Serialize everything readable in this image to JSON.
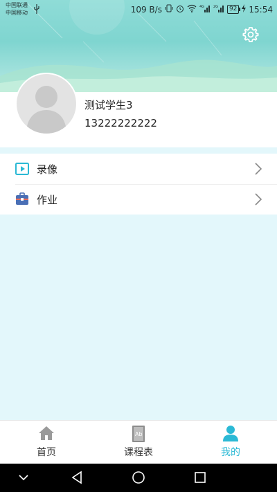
{
  "status_bar": {
    "carrier_1": "中国联通",
    "carrier_2": "中国移动",
    "net_speed": "109 B/s",
    "battery": "92",
    "time": "15:54"
  },
  "profile": {
    "name": "测试学生3",
    "phone": "13222222222"
  },
  "menu": {
    "items": [
      {
        "label": "录像",
        "icon": "video-play-icon"
      },
      {
        "label": "作业",
        "icon": "briefcase-icon"
      }
    ]
  },
  "tabbar": {
    "tabs": [
      {
        "label": "首页",
        "icon": "home-icon",
        "active": false
      },
      {
        "label": "课程表",
        "icon": "book-icon",
        "active": false
      },
      {
        "label": "我的",
        "icon": "person-icon",
        "active": true
      }
    ]
  },
  "colors": {
    "accent": "#2bb9d5",
    "header_teal": "#7fd5d0",
    "page_bg": "#e3f7fb"
  }
}
